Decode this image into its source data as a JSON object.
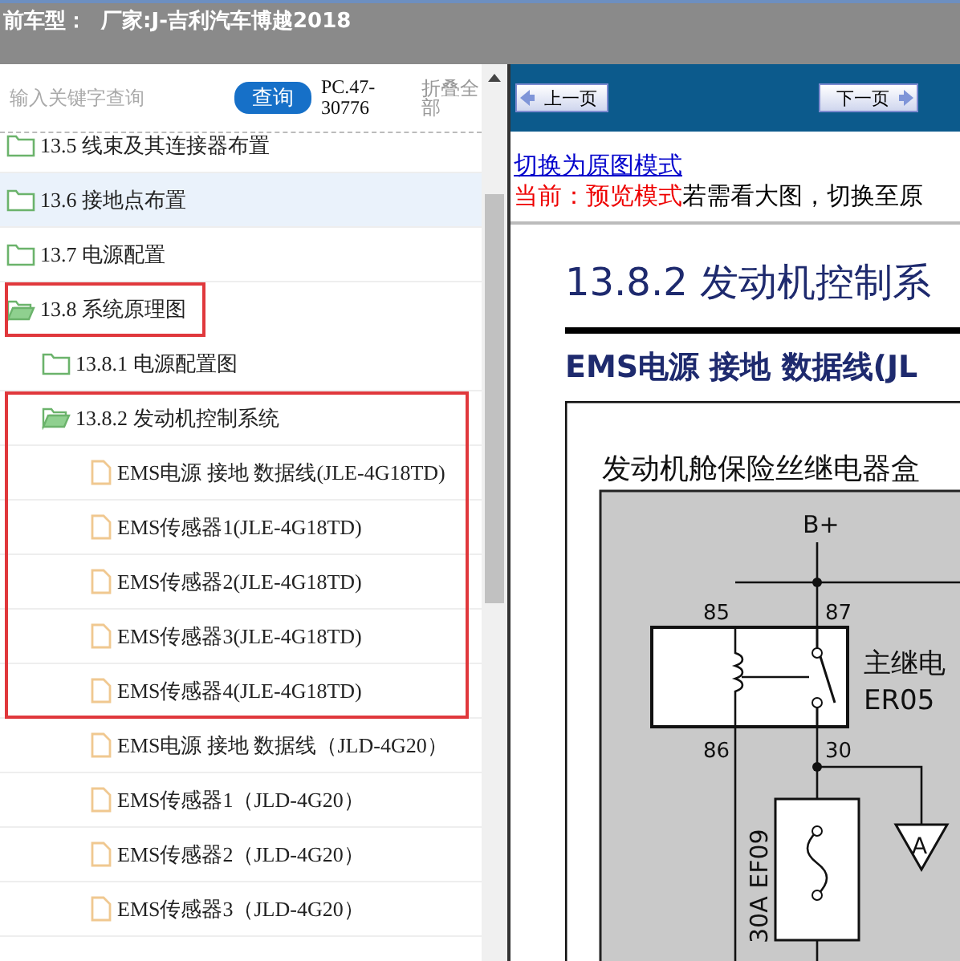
{
  "header": {
    "title": "前车型：  厂家:J-吉利汽车博越2018"
  },
  "search": {
    "placeholder": "输入关键字查询",
    "button": "查询",
    "code": "PC.47-30776",
    "collapse": "折叠全部"
  },
  "tree": [
    {
      "label": "13.5 线束及其连接器布置",
      "kind": "folder",
      "expanded": false,
      "selected": false,
      "highlighted": false
    },
    {
      "label": "13.6 接地点布置",
      "kind": "folder",
      "expanded": false,
      "selected": true,
      "highlighted": false
    },
    {
      "label": "13.7 电源配置",
      "kind": "folder",
      "expanded": false,
      "selected": false,
      "highlighted": false
    },
    {
      "label": "13.8 系统原理图",
      "kind": "folder",
      "expanded": true,
      "selected": false,
      "highlighted": true,
      "children": [
        {
          "label": "13.8.1 电源配置图",
          "kind": "folder",
          "expanded": false,
          "selected": false,
          "highlighted": false
        },
        {
          "label": "13.8.2 发动机控制系统",
          "kind": "folder",
          "expanded": true,
          "selected": false,
          "highlighted": true,
          "children": [
            {
              "label": "EMS电源 接地 数据线(JLE-4G18TD)",
              "kind": "doc",
              "selected": false,
              "highlighted": true
            },
            {
              "label": "EMS传感器1(JLE-4G18TD)",
              "kind": "doc",
              "selected": false,
              "highlighted": true
            },
            {
              "label": "EMS传感器2(JLE-4G18TD)",
              "kind": "doc",
              "selected": false,
              "highlighted": true
            },
            {
              "label": "EMS传感器3(JLE-4G18TD)",
              "kind": "doc",
              "selected": false,
              "highlighted": true
            },
            {
              "label": "EMS传感器4(JLE-4G18TD)",
              "kind": "doc",
              "selected": false,
              "highlighted": true
            },
            {
              "label": "EMS电源 接地 数据线（JLD-4G20）",
              "kind": "doc",
              "selected": false,
              "highlighted": false
            },
            {
              "label": "EMS传感器1（JLD-4G20）",
              "kind": "doc",
              "selected": false,
              "highlighted": false
            },
            {
              "label": "EMS传感器2（JLD-4G20）",
              "kind": "doc",
              "selected": false,
              "highlighted": false
            },
            {
              "label": "EMS传感器3（JLD-4G20）",
              "kind": "doc",
              "selected": false,
              "highlighted": false
            }
          ]
        }
      ]
    }
  ],
  "viewer": {
    "prev": "上一页",
    "next": "下一页",
    "switch_link": "切换为原图模式",
    "mode_label": "当前：预览模式",
    "mode_hint": "若需看大图，切换至原",
    "doc_title": "13.8.2 发动机控制系",
    "doc_subtitle": "EMS电源 接地 数据线(JL",
    "diagram": {
      "box_title": "发动机舱保险丝继电器盒",
      "supply": "B+",
      "pin_85": "85",
      "pin_87": "87",
      "pin_86": "86",
      "pin_30": "30",
      "relay_name": "主继电",
      "relay_code": "ER05",
      "fuse": "30A  EF09",
      "connector": "A"
    }
  }
}
